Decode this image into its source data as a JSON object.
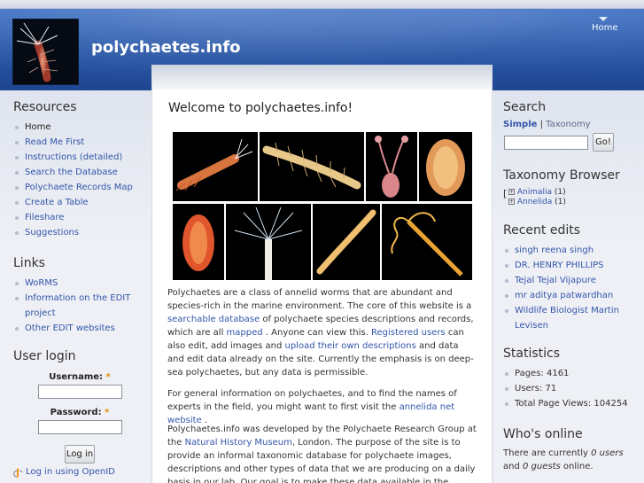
{
  "site": {
    "name": "polychaetes.info",
    "home_link": "Home"
  },
  "left_sidebar": {
    "resources_title": "Resources",
    "resources": [
      {
        "label": "Home"
      },
      {
        "label": "Read Me First"
      },
      {
        "label": "Instructions (detailed)"
      },
      {
        "label": "Search the Database"
      },
      {
        "label": "Polychaete Records Map"
      },
      {
        "label": "Create a Table"
      },
      {
        "label": "Fileshare"
      },
      {
        "label": "Suggestions"
      }
    ],
    "links_title": "Links",
    "links": [
      {
        "label": "WoRMS"
      },
      {
        "label": "Information on the EDIT project"
      },
      {
        "label": "Other EDIT websites"
      }
    ],
    "login": {
      "title": "User login",
      "username_label": "Username:",
      "password_label": "Password:",
      "required_mark": "*",
      "login_button": "Log in",
      "openid_link": "Log in using OpenID"
    }
  },
  "main": {
    "title": "Welcome to polychaetes.info!",
    "p1": {
      "t1": "Polychaetes are a class of annelid worms that are abundant and species-rich in the marine environment. The core of this website is a ",
      "link1": "searchable database",
      "t2": " of polychaete species descriptions and records, which are all ",
      "link2": "mapped",
      "t3": " . Anyone can view this. ",
      "link3": "Registered users",
      "t4": " can also edit, add images and ",
      "link4": "upload their own descriptions",
      "t5": " and data and edit data already on the site. Currently the emphasis is on deep-sea polychaetes, but any data is permissible."
    },
    "p2": {
      "t1": "For general information on polychaetes, and to find the names of experts in the field, you might want to first visit the ",
      "link1": "annelida net website",
      "t2": " ."
    },
    "p3": {
      "t1": "Polychaetes.info was developed by the Polychaete Research Group at the ",
      "link1": "Natural History Museum",
      "t2": ", London. The purpose of the site is to provide an informal taxonomic database for polychaete images, descriptions and other types of data that we are producing on a daily basis in our lab. Our goal is to make these data available in the public domain prior to their"
    }
  },
  "right_sidebar": {
    "search": {
      "title": "Search",
      "tab_simple": "Simple",
      "separator": "|",
      "tab_taxonomy": "Taxonomy",
      "go_button": "Go!"
    },
    "taxonomy_browser": {
      "title": "Taxonomy Browser",
      "items": [
        {
          "label": "Animalia",
          "count": "(1)"
        },
        {
          "label": "Annelida",
          "count": "(1)"
        }
      ]
    },
    "recent_edits": {
      "title": "Recent edits",
      "items": [
        {
          "label": "singh reena singh"
        },
        {
          "label": "DR. HENRY PHILLIPS"
        },
        {
          "label": "Tejal Tejal Vijapure"
        },
        {
          "label": "mr aditya patwardhan"
        },
        {
          "label": "Wildlife Biologist Martin Levisen"
        }
      ]
    },
    "statistics": {
      "title": "Statistics",
      "items": [
        {
          "label": "Pages: 4161"
        },
        {
          "label": "Users: 71"
        },
        {
          "label": "Total Page Views: 104254"
        }
      ]
    },
    "whos_online": {
      "title": "Who's online",
      "t1": "There are currently ",
      "em1": "0 users",
      "t2": " and ",
      "em2": "0 guests",
      "t3": " online."
    }
  },
  "colors": {
    "header_blue": "#2b5aab",
    "link": "#3355aa",
    "required": "#e08a00"
  }
}
